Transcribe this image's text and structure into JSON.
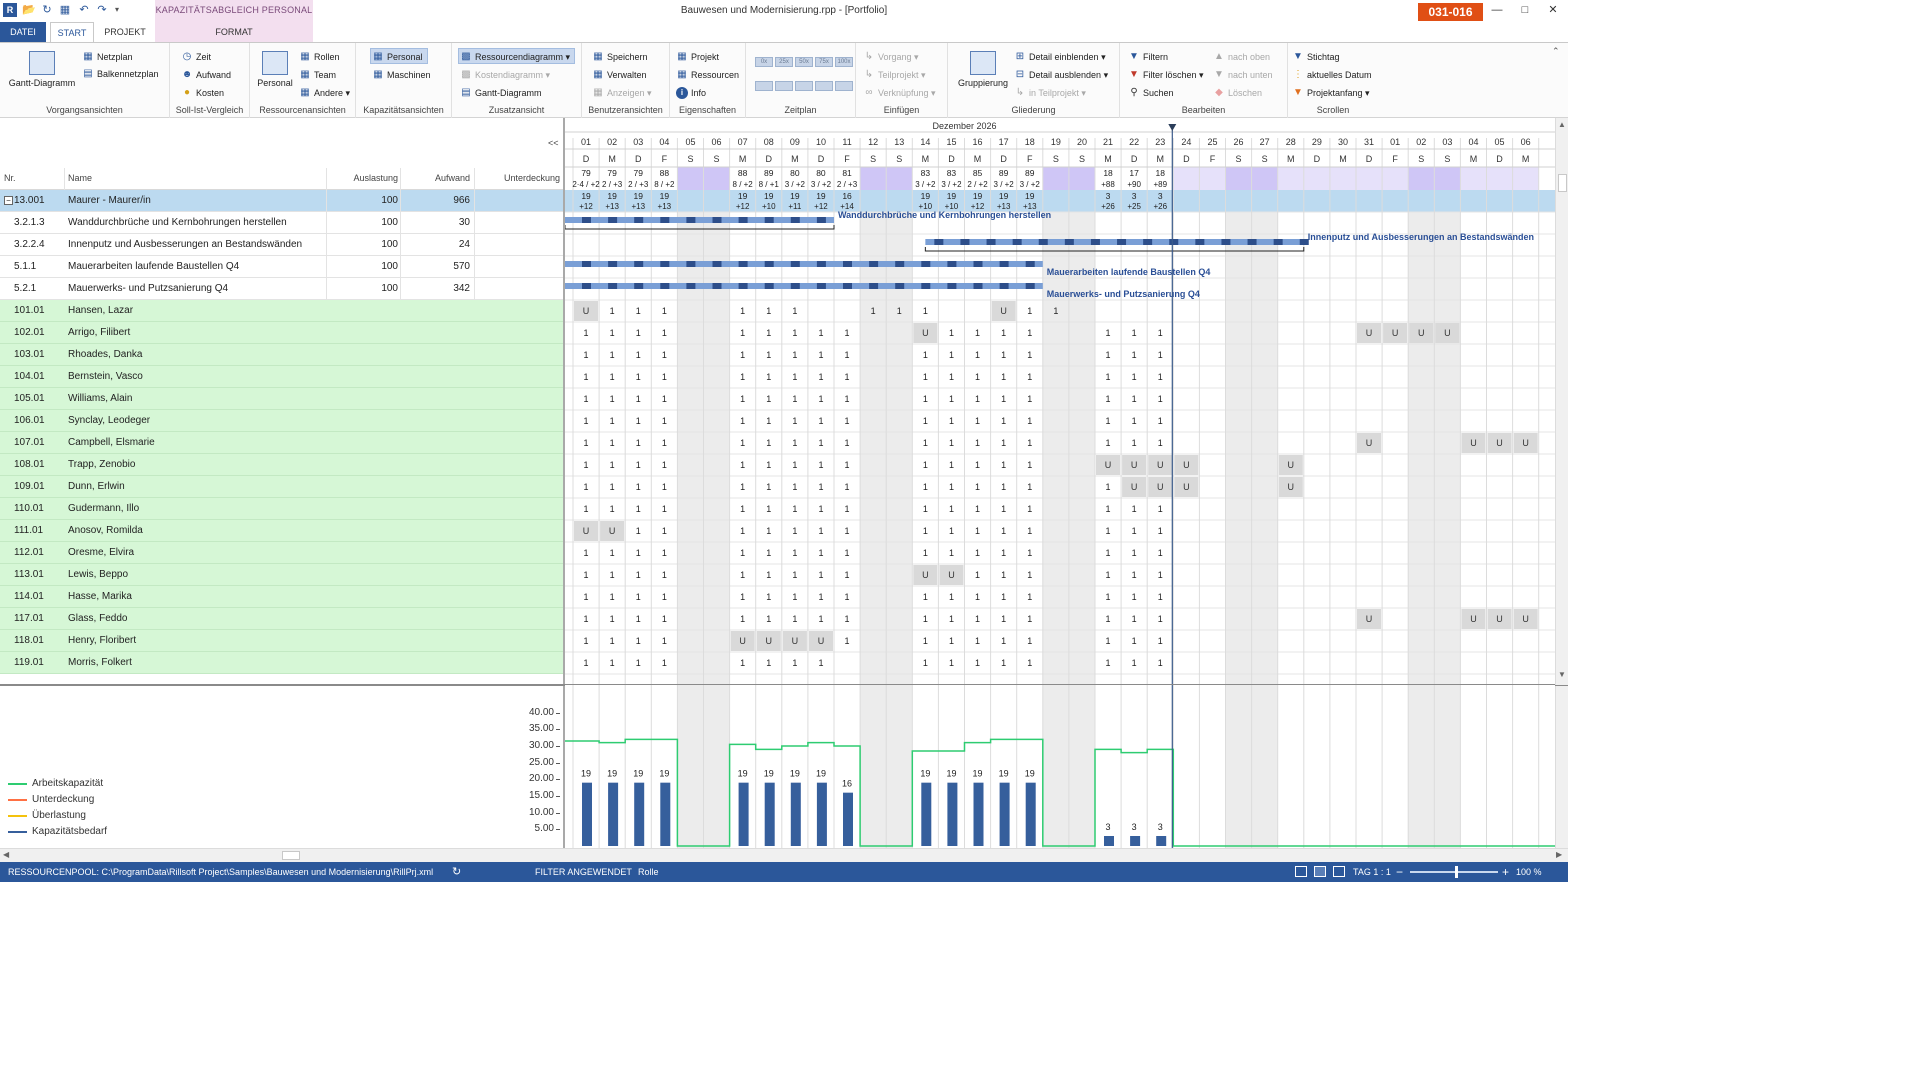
{
  "window": {
    "title": "Bauwesen und Modernisierung.rpp - [Portfolio]",
    "context_tab_title": "KAPAZITÄTSABGLEICH PERSONAL",
    "badge": "031-016"
  },
  "tabs": [
    "DATEI",
    "START",
    "PROJEKT",
    "FORMAT"
  ],
  "ribbon": {
    "vorgangsansichten": {
      "label": "Vorgangsansichten",
      "gantt": "Gantt-Diagramm",
      "netzplan": "Netzplan",
      "balkennetzplan": "Balkennetzplan"
    },
    "soll_ist": {
      "label": "Soll-Ist-Vergleich",
      "zeit": "Zeit",
      "aufwand": "Aufwand",
      "kosten": "Kosten"
    },
    "ressourcenansichten": {
      "label": "Ressourcenansichten",
      "personal": "Personal",
      "rollen": "Rollen",
      "team": "Team",
      "andere": "Andere"
    },
    "kapazitaetsansichten": {
      "label": "Kapazitätsansichten",
      "personal": "Personal",
      "maschinen": "Maschinen"
    },
    "zusatzansicht": {
      "label": "Zusatzansicht",
      "ressourcendiagramm": "Ressourcendiagramm",
      "kostendiagramm": "Kostendiagramm",
      "gantt": "Gantt-Diagramm"
    },
    "benutzeransichten": {
      "label": "Benutzeransichten",
      "speichern": "Speichern",
      "verwalten": "Verwalten",
      "anzeigen": "Anzeigen"
    },
    "eigenschaften": {
      "label": "Eigenschaften",
      "projekt": "Projekt",
      "ressourcen": "Ressourcen",
      "info": "Info"
    },
    "zeitplan": {
      "label": "Zeitplan",
      "zoom_labels": [
        "0x",
        "25x",
        "50x",
        "75x",
        "100x"
      ]
    },
    "einfuegen": {
      "label": "Einfügen",
      "vorgang": "Vorgang",
      "teilprojekt": "Teilprojekt",
      "verknuepfung": "Verknüpfung"
    },
    "gliederung": {
      "label": "Gliederung",
      "gruppierung": "Gruppierung",
      "detail_ein": "Detail einblenden",
      "detail_aus": "Detail ausblenden",
      "in_teilprojekt": "in Teilprojekt"
    },
    "bearbeiten": {
      "label": "Bearbeiten",
      "filtern": "Filtern",
      "filter_loeschen": "Filter löschen",
      "suchen": "Suchen",
      "nach_oben": "nach oben",
      "nach_unten": "nach unten",
      "loeschen": "Löschen"
    },
    "scrollen": {
      "label": "Scrollen",
      "stichtag": "Stichtag",
      "aktuelles_datum": "aktuelles Datum",
      "projektanfang": "Projektanfang"
    }
  },
  "grid": {
    "collapse": "<<",
    "headers": {
      "nr": "Nr.",
      "name": "Name",
      "auslastung": "Auslastung",
      "aufwand": "Aufwand",
      "unterdeckung": "Unterdeckung"
    },
    "rows": [
      {
        "nr": "13.001",
        "name": "Maurer - Maurer/in",
        "auslastung": "100",
        "aufwand": "966",
        "kind": "group"
      },
      {
        "nr": "3.2.1.3",
        "name": "Wanddurchbrüche und Kernbohrungen herstellen",
        "auslastung": "100",
        "aufwand": "30",
        "kind": "task"
      },
      {
        "nr": "3.2.2.4",
        "name": "Innenputz und Ausbesserungen an Bestandswänden",
        "auslastung": "100",
        "aufwand": "24",
        "kind": "task"
      },
      {
        "nr": "5.1.1",
        "name": "Mauerarbeiten laufende Baustellen Q4",
        "auslastung": "100",
        "aufwand": "570",
        "kind": "task"
      },
      {
        "nr": "5.2.1",
        "name": "Mauerwerks- und Putzsanierung Q4",
        "auslastung": "100",
        "aufwand": "342",
        "kind": "task"
      },
      {
        "nr": "101.01",
        "name": "Hansen, Lazar",
        "auslastung": "",
        "aufwand": "",
        "kind": "res"
      },
      {
        "nr": "102.01",
        "name": "Arrigo, Filibert",
        "auslastung": "",
        "aufwand": "",
        "kind": "res"
      },
      {
        "nr": "103.01",
        "name": "Rhoades, Danka",
        "auslastung": "",
        "aufwand": "",
        "kind": "res"
      },
      {
        "nr": "104.01",
        "name": "Bernstein, Vasco",
        "auslastung": "",
        "aufwand": "",
        "kind": "res"
      },
      {
        "nr": "105.01",
        "name": "Williams, Alain",
        "auslastung": "",
        "aufwand": "",
        "kind": "res"
      },
      {
        "nr": "106.01",
        "name": "Synclay, Leodeger",
        "auslastung": "",
        "aufwand": "",
        "kind": "res"
      },
      {
        "nr": "107.01",
        "name": "Campbell, Elsmarie",
        "auslastung": "",
        "aufwand": "",
        "kind": "res"
      },
      {
        "nr": "108.01",
        "name": "Trapp, Zenobio",
        "auslastung": "",
        "aufwand": "",
        "kind": "res"
      },
      {
        "nr": "109.01",
        "name": "Dunn, Erlwin",
        "auslastung": "",
        "aufwand": "",
        "kind": "res"
      },
      {
        "nr": "110.01",
        "name": "Gudermann, Illo",
        "auslastung": "",
        "aufwand": "",
        "kind": "res"
      },
      {
        "nr": "111.01",
        "name": "Anosov, Romilda",
        "auslastung": "",
        "aufwand": "",
        "kind": "res"
      },
      {
        "nr": "112.01",
        "name": "Oresme, Elvira",
        "auslastung": "",
        "aufwand": "",
        "kind": "res"
      },
      {
        "nr": "113.01",
        "name": "Lewis, Beppo",
        "auslastung": "",
        "aufwand": "",
        "kind": "res"
      },
      {
        "nr": "114.01",
        "name": "Hasse, Marika",
        "auslastung": "",
        "aufwand": "",
        "kind": "res"
      },
      {
        "nr": "117.01",
        "name": "Glass, Feddo",
        "auslastung": "",
        "aufwand": "",
        "kind": "res"
      },
      {
        "nr": "118.01",
        "name": "Henry, Floribert",
        "auslastung": "",
        "aufwand": "",
        "kind": "res"
      },
      {
        "nr": "119.01",
        "name": "Morris, Folkert",
        "auslastung": "",
        "aufwand": "",
        "kind": "res"
      }
    ]
  },
  "timeline": {
    "month": "Dezember 2026",
    "days": [
      "01",
      "02",
      "03",
      "04",
      "05",
      "06",
      "07",
      "08",
      "09",
      "10",
      "11",
      "12",
      "13",
      "14",
      "15",
      "16",
      "17",
      "18",
      "19",
      "20",
      "21",
      "22",
      "23",
      "24",
      "25",
      "26",
      "27",
      "28",
      "29",
      "30",
      "31",
      "01",
      "02",
      "03",
      "04",
      "05",
      "06"
    ],
    "weekdays": [
      "D",
      "M",
      "D",
      "F",
      "S",
      "S",
      "M",
      "D",
      "M",
      "D",
      "F",
      "S",
      "S",
      "M",
      "D",
      "M",
      "D",
      "F",
      "S",
      "S",
      "M",
      "D",
      "M",
      "D",
      "F",
      "S",
      "S",
      "M",
      "D",
      "M",
      "D",
      "F",
      "S",
      "S",
      "M",
      "D",
      "M"
    ],
    "weekend": [
      4,
      5,
      11,
      12,
      18,
      19,
      25,
      26,
      32,
      33
    ],
    "holiday": [
      23,
      24,
      25,
      26,
      27,
      28,
      29,
      30,
      31,
      32,
      33,
      34,
      35,
      36
    ],
    "load_top": [
      "79",
      "79",
      "79",
      "88",
      "",
      "",
      "88",
      "89",
      "80",
      "80",
      "81",
      "",
      "",
      "83",
      "83",
      "85",
      "89",
      "89",
      "",
      "",
      "18",
      "17",
      "18"
    ],
    "load_sub": [
      "2·4 / +2",
      "2 / +3",
      "2 / +3",
      "8 / +2",
      "",
      "",
      "8 / +2",
      "8 / +1",
      "3 / +2",
      "3 / +2",
      "2 / +3",
      "",
      "",
      "3 / +2",
      "3 / +2",
      "2 / +2",
      "3 / +2",
      "3 / +2",
      "",
      "",
      "+88",
      "+90",
      "+89"
    ],
    "group_top": [
      "19",
      "19",
      "19",
      "19",
      "",
      "",
      "19",
      "19",
      "19",
      "19",
      "16",
      "",
      "",
      "19",
      "19",
      "19",
      "19",
      "19",
      "",
      "",
      "3",
      "3",
      "3"
    ],
    "group_sub": [
      "+12",
      "+13",
      "+13",
      "+13",
      "",
      "",
      "+12",
      "+10",
      "+11",
      "+12",
      "+14",
      "",
      "",
      "+10",
      "+10",
      "+12",
      "+13",
      "+13",
      "",
      "",
      "+26",
      "+25",
      "+26"
    ],
    "task_labels": [
      "Wanddurchbrüche und Kernbohrungen herstellen",
      "Innenputz und Ausbesserungen an Bestandswänden",
      "Mauerarbeiten laufende Baustellen Q4",
      "Mauerwerks- und Putzsanierung Q4"
    ],
    "resource_cells": [
      "U111..111..111..U11.............",
      "1111..11111..U1111..111.......UUUU",
      "1111..11111..11111..111.........",
      "1111..11111..11111..111.........",
      "1111..11111..11111..111.........",
      "1111..11111..11111..111.........",
      "1111..11111..11111..111.......U...UUUU",
      "1111..11111..11111..UUUU...U.......",
      "1111..11111..11111..1UUU...U.......",
      "1111..11111..11111..111.........",
      "UU11..11111..11111..111.........",
      "1111..11111..11111..111.........",
      "1111..11111..UU111..111.........",
      "1111..11111..11111..111.........",
      "1111..11111..11111..111.......U...UUUU",
      "1111..UUUU1..11111..111.........",
      "1111..1111...11111..111........."
    ]
  },
  "chart_data": {
    "type": "bar",
    "categories": [
      "01",
      "02",
      "03",
      "04",
      "05",
      "06",
      "07",
      "08",
      "09",
      "10",
      "11",
      "12",
      "13",
      "14",
      "15",
      "16",
      "17",
      "18",
      "19",
      "20",
      "21",
      "22",
      "23"
    ],
    "series": [
      {
        "name": "Kapazitätsbedarf",
        "values": [
          19,
          19,
          19,
          19,
          0,
          0,
          19,
          19,
          19,
          19,
          16,
          0,
          0,
          19,
          19,
          19,
          19,
          19,
          0,
          0,
          3,
          3,
          3
        ]
      },
      {
        "name": "Arbeitskapazität",
        "values": [
          31.5,
          31,
          32,
          32,
          0,
          0,
          30.5,
          29,
          30,
          31,
          30,
          0,
          0,
          28.5,
          28.5,
          31,
          32,
          32,
          0,
          0,
          29,
          28,
          29
        ]
      }
    ],
    "bar_labels": [
      "19",
      "19",
      "19",
      "19",
      "",
      "",
      "19",
      "19",
      "19",
      "19",
      "16",
      "",
      "",
      "19",
      "19",
      "19",
      "19",
      "19",
      "",
      "",
      "3",
      "3",
      "3"
    ],
    "yticks": [
      "40.00",
      "35.00",
      "30.00",
      "25.00",
      "20.00",
      "15.00",
      "10.00",
      "5.00"
    ],
    "ylim": [
      0,
      42
    ],
    "legend": [
      "Arbeitskapazität",
      "Unterdeckung",
      "Überlastung",
      "Kapazitätsbedarf"
    ],
    "colors": {
      "Arbeitskapazität": "#2ecc71",
      "Unterdeckung": "#ff7043",
      "Überlastung": "#f4c20d",
      "Kapazitätsbedarf": "#365f9c"
    }
  },
  "status": {
    "pool": "RESSOURCENPOOL: C:\\ProgramData\\Rillsoft Project\\Samples\\Bauwesen und Modernisierung\\RillPrj.xml",
    "filter": "FILTER ANGEWENDET",
    "rolle": "Rolle",
    "tag": "TAG 1 : 1",
    "zoom": "100 %"
  }
}
